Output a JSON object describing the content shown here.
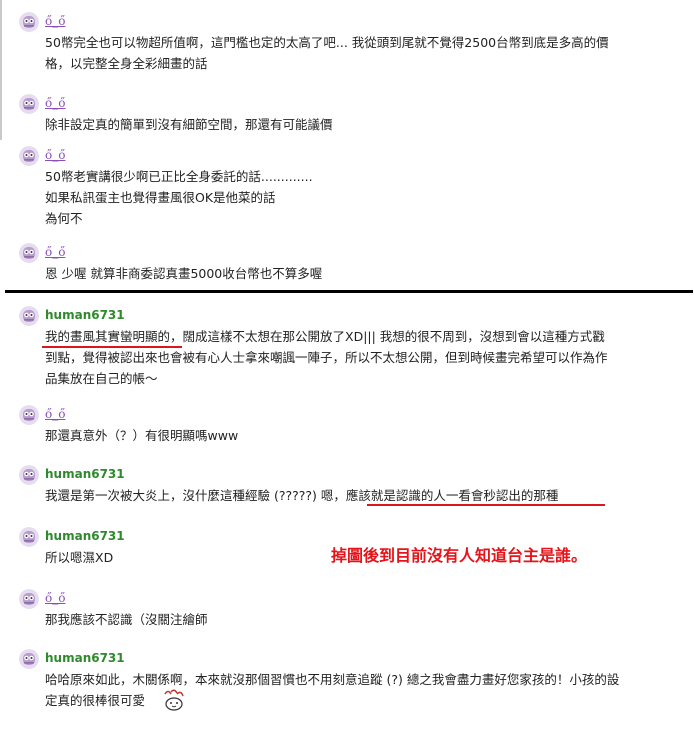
{
  "comments": [
    {
      "username": "ő_ő",
      "lines": [
        "50幣完全也可以物超所值啊，這門檻也定的太高了吧... 我從頭到尾就不覺得2500台幣到底是多高的價",
        "格，以完整全身全彩細畫的話"
      ]
    },
    {
      "username": "ő_ő",
      "lines": [
        "除非設定真的簡單到沒有細節空間，那還有可能議價"
      ]
    },
    {
      "username": "ő_ő",
      "lines": [
        "50幣老實講很少啊已正比全身委託的話.............",
        "如果私訊蛋主也覺得畫風很OK是他菜的話",
        "為何不"
      ]
    },
    {
      "username": "ő_ő",
      "lines": [
        "恩 少喔 就算非商委認真畫5000收台幣也不算多喔"
      ]
    },
    {
      "username": "human6731",
      "lines": [
        "我的畫風其實蠻明顯的，闊成這樣不太想在那公開放了XD||| 我想的很不周到，沒想到會以這種方式戳",
        "到點，覺得被認出來也會被有心人士拿來嘲諷一陣子，所以不太想公開，但到時候畫完希望可以作為作",
        "品集放在自己的帳～"
      ]
    },
    {
      "username": "ő_ő",
      "lines": [
        "那還真意外（？）有很明顯嗎www"
      ]
    },
    {
      "username": "human6731",
      "lines": [
        "我還是第一次被大炎上，沒什麼這種經驗 (?????) 嗯，應該就是認識的人一看會秒認出的那種"
      ]
    },
    {
      "username": "human6731",
      "lines": [
        "所以嗯濕XD"
      ]
    },
    {
      "username": "ő_ő",
      "lines": [
        "那我應該不認識（沒關注繪師"
      ]
    },
    {
      "username": "human6731",
      "lines": [
        "哈哈原來如此，木關係啊，本來就沒那個習慣也不用刻意追蹤 (?) 總之我會盡力畫好您家孩的！小孩的設",
        "定真的很棒很可愛"
      ]
    }
  ],
  "annotation": {
    "text": "掉圖後到目前沒有人知道台主是誰。",
    "color": "#e5141a"
  },
  "colors": {
    "green_username": "#2f8a2c",
    "purple_username": "#8a4fb8",
    "underline_red": "#d8181c",
    "divider": "#000000"
  },
  "icons": {
    "avatar": "owl-avatar-icon",
    "emoji": "paw-emoji-icon"
  }
}
